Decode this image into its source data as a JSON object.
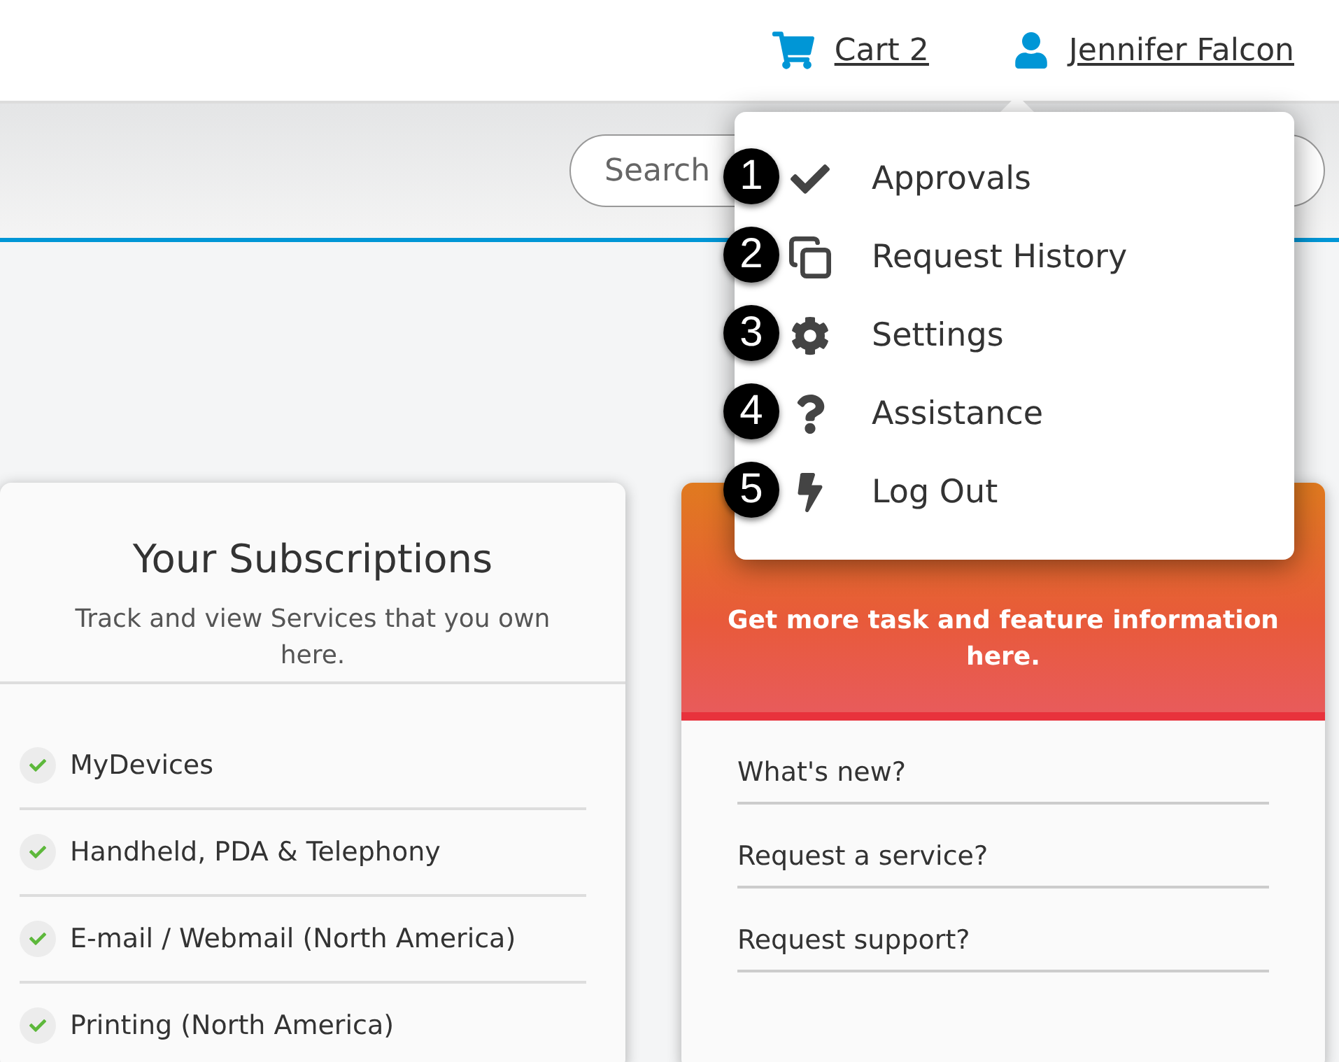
{
  "header": {
    "cart": {
      "label": "Cart 2"
    },
    "user": {
      "name": "Jennifer Falcon"
    }
  },
  "search": {
    "placeholder": "Search"
  },
  "user_menu": {
    "items": [
      {
        "number": "1",
        "label": "Approvals",
        "kind": "check"
      },
      {
        "number": "2",
        "label": "Request History",
        "kind": "copy"
      },
      {
        "number": "3",
        "label": "Settings",
        "kind": "gear"
      },
      {
        "number": "4",
        "label": "Assistance",
        "kind": "help"
      },
      {
        "number": "5",
        "label": "Log Out",
        "kind": "bolt"
      }
    ]
  },
  "subscriptions": {
    "title": "Your Subscriptions",
    "description": "Track and view Services that you own here.",
    "items": [
      {
        "label": "MyDevices"
      },
      {
        "label": "Handheld, PDA & Telephony"
      },
      {
        "label": "E-mail / Webmail (North America)"
      },
      {
        "label": "Printing (North America)"
      }
    ]
  },
  "assistance": {
    "description": "Get more task and feature information here.",
    "links": [
      {
        "label": "What's new?"
      },
      {
        "label": "Request a service?"
      },
      {
        "label": "Request support?"
      }
    ]
  }
}
